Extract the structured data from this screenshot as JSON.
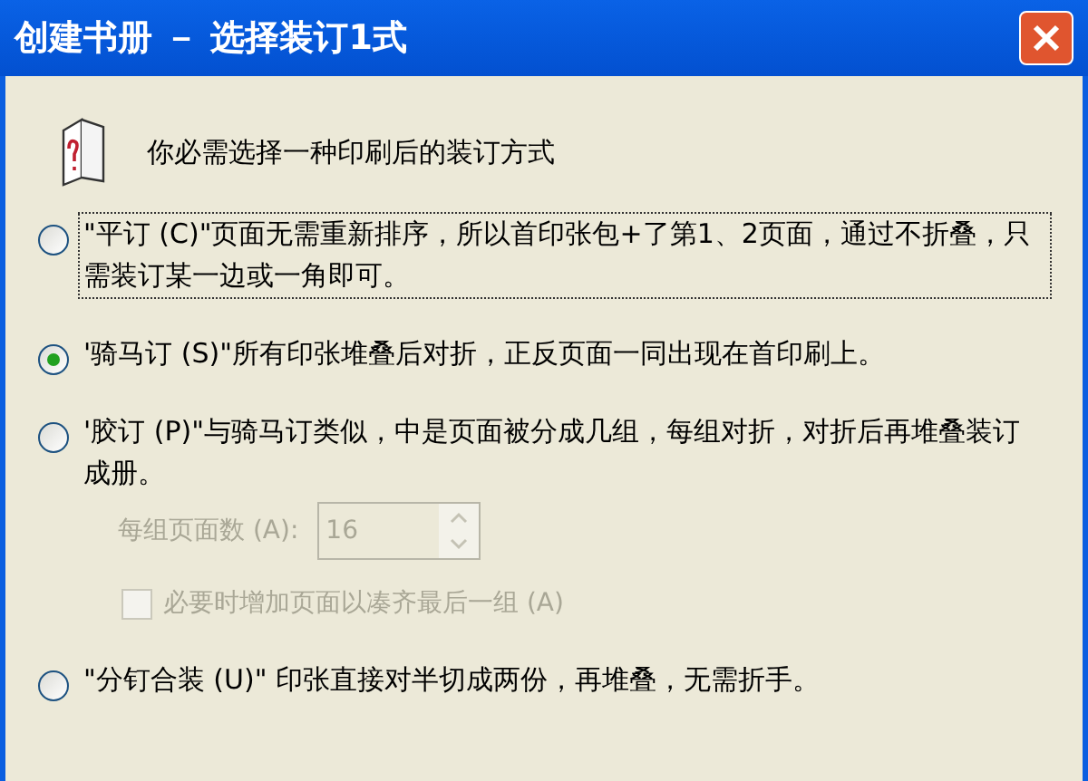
{
  "window": {
    "title": "创建书册 － 选择装订1式"
  },
  "intro": "你必需选择一种印刷后的装订方式",
  "options": [
    {
      "text": "\"平订 (C)\"页面无需重新排序，所以首印张包+了第1、2页面，通过不折叠，只需装订某一边或一角即可。",
      "selected": false,
      "focused": true
    },
    {
      "text": "'骑马订 (S)\"所有印张堆叠后对折，正反页面一同出现在首印刷上。",
      "selected": true,
      "focused": false
    },
    {
      "text": "'胶订 (P)\"与骑马订类似，中是页面被分成几组，每组对折，对折后再堆叠装订成册。",
      "selected": false,
      "focused": false,
      "pages_per_group": {
        "label": "每组页面数 (A):",
        "value": "16",
        "disabled": true
      },
      "pad_checkbox": {
        "label": "必要时增加页面以凑齐最后一组 (A)",
        "checked": false,
        "disabled": true
      }
    },
    {
      "text": "\"分钉合装 (U)\" 印张直接对半切成两份，再堆叠，无需折手。",
      "selected": false,
      "focused": false
    }
  ]
}
